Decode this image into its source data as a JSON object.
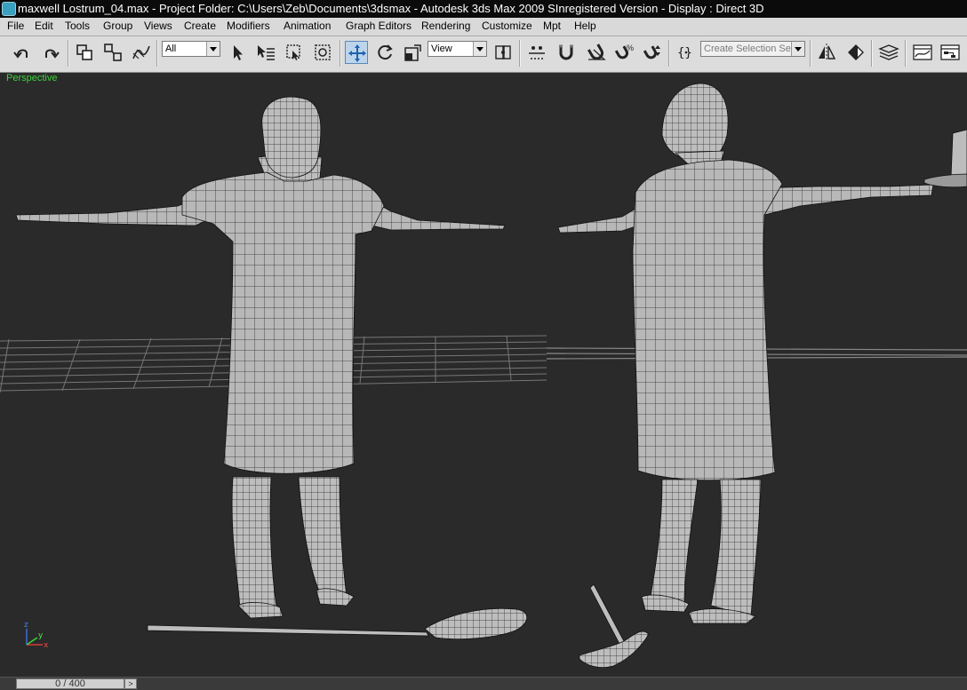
{
  "window": {
    "title": "maxwell Lostrum_04.max       - Project Folder: C:\\Users\\Zeb\\Documents\\3dsmax       - Autodesk 3ds Max  2009 SInregistered Version       - Display : Direct 3D"
  },
  "menu": [
    {
      "label": "File"
    },
    {
      "label": "Edit"
    },
    {
      "label": "Tools"
    },
    {
      "label": "Group"
    },
    {
      "label": "Views"
    },
    {
      "label": "Create"
    },
    {
      "label": "Modifiers"
    },
    {
      "label": "Animation"
    },
    {
      "label": "Graph Editors"
    },
    {
      "label": "Rendering"
    },
    {
      "label": "Customize"
    },
    {
      "label": "Mpt"
    },
    {
      "label": "Help"
    }
  ],
  "toolbar": {
    "selection_filter": "All",
    "reference_coord": "View",
    "named_selection_placeholder": "Create Selection Se"
  },
  "viewport": {
    "label": "Perspective",
    "axis": {
      "x": "x",
      "y": "y",
      "z": "z"
    }
  },
  "timeline": {
    "frame": "0 / 400",
    "next_label": ">"
  }
}
